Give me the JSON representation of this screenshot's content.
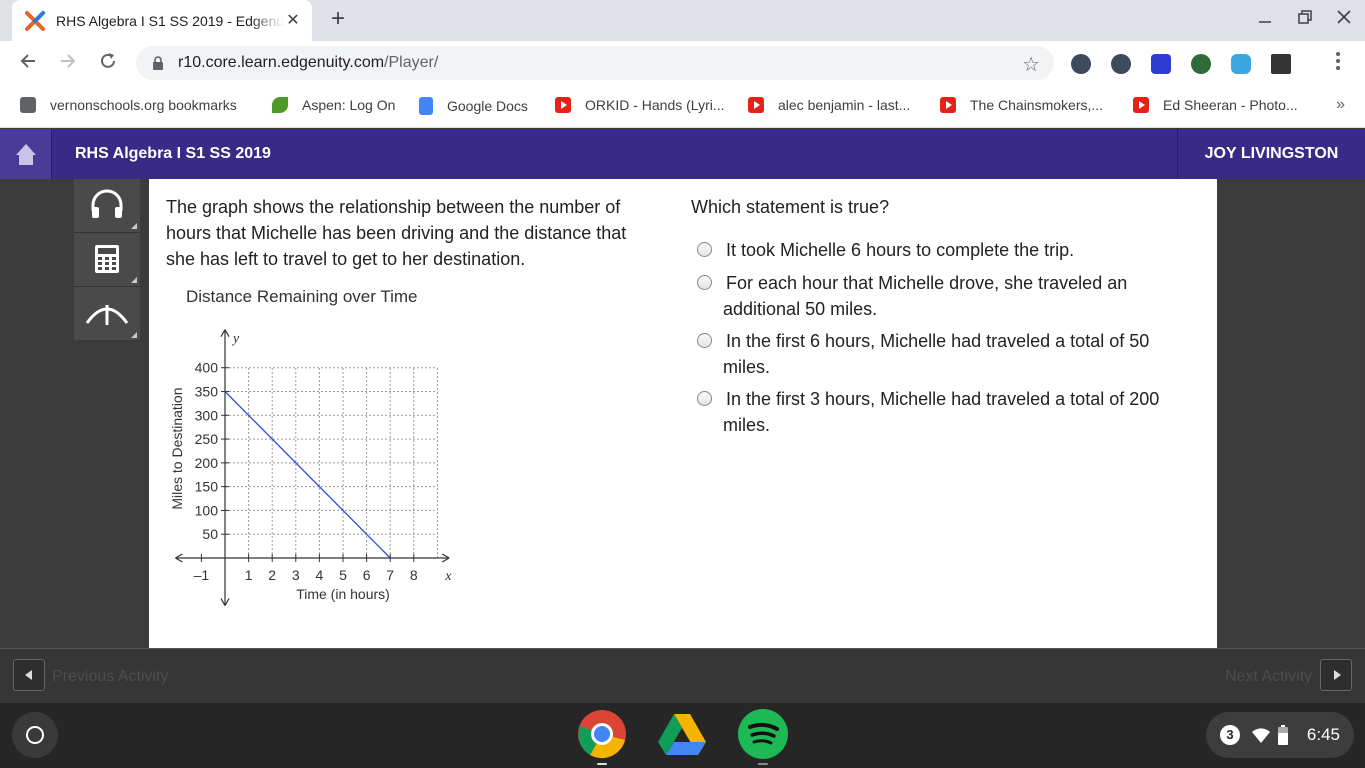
{
  "browser": {
    "tab_title": "RHS Algebra I S1 SS 2019 - Edgenuity",
    "url_host": "r10.core.learn.edgenuity.com",
    "url_path": "/Player/",
    "new_tab_label": "+",
    "close_tab_label": "✕",
    "bookmarks": [
      {
        "label": "vernonschools.org bookmarks",
        "icon": "folder-icon"
      },
      {
        "label": "Aspen: Log On",
        "icon": "aspen-leaf-icon"
      },
      {
        "label": "Google Docs",
        "icon": "google-docs-icon"
      },
      {
        "label": "ORKID - Hands (Lyri...",
        "icon": "youtube-icon"
      },
      {
        "label": "alec benjamin - last...",
        "icon": "youtube-icon"
      },
      {
        "label": "The Chainsmokers,...",
        "icon": "youtube-icon"
      },
      {
        "label": "Ed Sheeran - Photo...",
        "icon": "youtube-icon"
      }
    ],
    "bookmarks_more": "»"
  },
  "app": {
    "course_title": "RHS Algebra I S1 SS 2019",
    "user_name": "JOY LIVINGSTON",
    "accent": "#3a2a87"
  },
  "problem": {
    "prompt": "The graph shows the relationship between the number of hours that Michelle has been driving and the distance that she has left to travel to get to her destination.",
    "question": "Which statement is true?",
    "options": [
      {
        "text": "It took Michelle 6 hours to complete the trip."
      },
      {
        "text": "For each hour that Michelle drove, she traveled an additional 50 miles."
      },
      {
        "text": "In the first 6 hours, Michelle had traveled a total of 50 miles."
      },
      {
        "text": "In the first 3 hours, Michelle had traveled a total of 200 miles."
      }
    ]
  },
  "chart_data": {
    "type": "line",
    "title": "Distance Remaining over Time",
    "xlabel": "Time (in hours)",
    "ylabel": "Miles to Destination",
    "x_axis_letter": "x",
    "y_axis_letter": "y",
    "xlim": [
      -1,
      9
    ],
    "ylim": [
      -50,
      450
    ],
    "x_ticks": [
      -1,
      1,
      2,
      3,
      4,
      5,
      6,
      7,
      8
    ],
    "x_tick_labels": [
      "–1",
      "1",
      "2",
      "3",
      "4",
      "5",
      "6",
      "7",
      "8"
    ],
    "y_ticks": [
      50,
      100,
      150,
      200,
      250,
      300,
      350,
      400
    ],
    "grid": true,
    "series": [
      {
        "points": [
          [
            0,
            350
          ],
          [
            7,
            0
          ]
        ],
        "color": "#2b4fd6"
      }
    ]
  },
  "footer": {
    "prev_label": "Previous Activity",
    "next_label": "Next Activity"
  },
  "shelf": {
    "notification_count": "3",
    "time": "6:45",
    "apps": [
      "chrome-icon",
      "google-drive-icon",
      "spotify-icon"
    ]
  }
}
